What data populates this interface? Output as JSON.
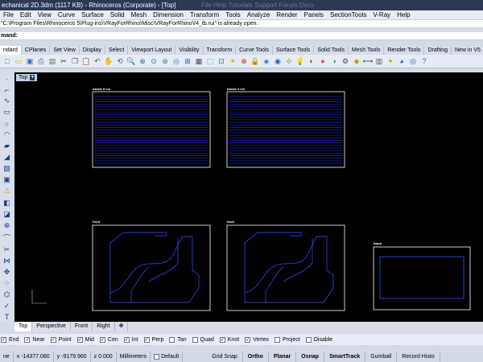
{
  "window": {
    "title": "echanical 2D.3dm (1117 KB) - Rhinoceros (Corporate) - [Top]",
    "background_ghost": "File    Help    Tutorials    Support    Forum    Docs"
  },
  "menu": [
    "File",
    "Edit",
    "View",
    "Curve",
    "Surface",
    "Solid",
    "Mesh",
    "Dimension",
    "Transform",
    "Tools",
    "Analyze",
    "Render",
    "Panels",
    "SectionTools",
    "V-Ray",
    "Help"
  ],
  "command": {
    "history": "\"C:\\Program Files\\Rhinoceros 5\\Plug-ins\\VRayForRhino\\Misc\\VRayForRhinoV4_tb.rui\" is already open.",
    "prompt": "mand:"
  },
  "toolbar_tabs": [
    {
      "label": "ndard",
      "active": true
    },
    {
      "label": "CPlanes"
    },
    {
      "label": "Set View"
    },
    {
      "label": "Display"
    },
    {
      "label": "Select"
    },
    {
      "label": "Viewport Layout"
    },
    {
      "label": "Visibility"
    },
    {
      "label": "Transform"
    },
    {
      "label": "Curve Tools"
    },
    {
      "label": "Surface Tools"
    },
    {
      "label": "Solid Tools"
    },
    {
      "label": "Mesh Tools"
    },
    {
      "label": "Render Tools"
    },
    {
      "label": "Drafting"
    },
    {
      "label": "New in V5"
    }
  ],
  "toolbar_icons": [
    {
      "name": "new-icon",
      "glyph": "□"
    },
    {
      "name": "open-icon",
      "glyph": "▭"
    },
    {
      "name": "save-icon",
      "glyph": "▣"
    },
    {
      "name": "print-icon",
      "glyph": "⎙"
    },
    {
      "name": "import-icon",
      "glyph": "▤"
    },
    {
      "name": "cut-icon",
      "glyph": "✂"
    },
    {
      "name": "copy-icon",
      "glyph": "❐"
    },
    {
      "name": "paste-icon",
      "glyph": "📋"
    },
    {
      "name": "undo-icon",
      "glyph": "↶"
    },
    {
      "name": "pan-hand-icon",
      "glyph": "✋"
    },
    {
      "name": "rotate-icon",
      "glyph": "⟲"
    },
    {
      "name": "zoom-icon",
      "glyph": "🔍"
    },
    {
      "name": "zoom-window-icon",
      "glyph": "⊕"
    },
    {
      "name": "zoom-extents-icon",
      "glyph": "⊙"
    },
    {
      "name": "zoom-selected-icon",
      "glyph": "⊚"
    },
    {
      "name": "zoom-all-icon",
      "glyph": "◎"
    },
    {
      "name": "four-views-icon",
      "glyph": "⊞"
    },
    {
      "name": "grid-icon",
      "glyph": "▦"
    },
    {
      "name": "cplane-icon",
      "glyph": "⬚"
    },
    {
      "name": "select-icon",
      "glyph": "⊡"
    },
    {
      "name": "show-icon",
      "glyph": "☀"
    },
    {
      "name": "hide-icon",
      "glyph": "⊗"
    },
    {
      "name": "lock-icon",
      "glyph": "🔒"
    },
    {
      "name": "layer-icon",
      "glyph": "◈"
    },
    {
      "name": "properties-icon",
      "glyph": "◉"
    },
    {
      "name": "osnap-icon",
      "glyph": "⊹"
    },
    {
      "name": "light-icon",
      "glyph": "💡"
    },
    {
      "name": "render-icon",
      "glyph": "◐"
    },
    {
      "name": "material-icon",
      "glyph": "●"
    },
    {
      "name": "environment-icon",
      "glyph": "◑"
    },
    {
      "name": "options-icon",
      "glyph": "⚙"
    },
    {
      "name": "color-icon",
      "glyph": "◆"
    },
    {
      "name": "dimension-icon",
      "glyph": "⟷"
    },
    {
      "name": "layout-icon",
      "glyph": "▥"
    },
    {
      "name": "wand-icon",
      "glyph": "✦"
    },
    {
      "name": "raytrace-icon",
      "glyph": "◕"
    },
    {
      "name": "vray-render-icon",
      "glyph": "◎"
    },
    {
      "name": "help-icon",
      "glyph": "?"
    }
  ],
  "left_tools": [
    {
      "name": "point-icon",
      "glyph": "·"
    },
    {
      "name": "polyline-icon",
      "glyph": "⌐"
    },
    {
      "name": "curve-icon",
      "glyph": "∿"
    },
    {
      "name": "rectangle-icon",
      "glyph": "▭"
    },
    {
      "name": "circle-icon",
      "glyph": "○"
    },
    {
      "name": "arc-icon",
      "glyph": "◠"
    },
    {
      "name": "surface-icon",
      "glyph": "▰"
    },
    {
      "name": "sweep-icon",
      "glyph": "◢"
    },
    {
      "name": "loft-icon",
      "glyph": "▧"
    },
    {
      "name": "box-icon",
      "glyph": "▣"
    },
    {
      "name": "warning-icon",
      "glyph": "⚠",
      "warn": true
    },
    {
      "name": "solid-icon",
      "glyph": "◧"
    },
    {
      "name": "mesh-icon",
      "glyph": "◪"
    },
    {
      "name": "boolean-icon",
      "glyph": "⊕"
    },
    {
      "name": "fillet-icon",
      "glyph": "⌒"
    },
    {
      "name": "trim-icon",
      "glyph": "✂"
    },
    {
      "name": "join-icon",
      "glyph": "⋈"
    },
    {
      "name": "move-icon",
      "glyph": "✥"
    },
    {
      "name": "array-icon",
      "glyph": "⁘"
    },
    {
      "name": "analyze-icon",
      "glyph": "⌬"
    },
    {
      "name": "check-icon",
      "glyph": "✓"
    },
    {
      "name": "text-icon",
      "glyph": "T"
    }
  ],
  "viewport": {
    "name": "Top",
    "labels": [
      "bands 5 cm",
      "bands 3 cm",
      "front",
      "back",
      "black"
    ]
  },
  "view_tabs": [
    {
      "label": "Top",
      "active": true
    },
    {
      "label": "Perspective"
    },
    {
      "label": "Front"
    },
    {
      "label": "Right"
    },
    {
      "label": "✥"
    }
  ],
  "osnaps": [
    {
      "label": "End",
      "checked": true
    },
    {
      "label": "Near",
      "checked": true
    },
    {
      "label": "Point",
      "checked": true
    },
    {
      "label": "Mid",
      "checked": true
    },
    {
      "label": "Cen",
      "checked": true
    },
    {
      "label": "Int",
      "checked": true
    },
    {
      "label": "Perp",
      "checked": true
    },
    {
      "label": "Tan",
      "checked": false
    },
    {
      "label": "Quad",
      "checked": false
    },
    {
      "label": "Knot",
      "checked": true
    },
    {
      "label": "Vertex",
      "checked": true
    },
    {
      "label": "Project",
      "checked": false
    },
    {
      "label": "Disable",
      "checked": false
    }
  ],
  "status": {
    "plane": "ne",
    "x": "x -14377.080",
    "y": "y -9179.960",
    "z": "z 0.000",
    "units": "Millimeters",
    "layer": "Default",
    "toggles": [
      "Grid Snap",
      "Ortho",
      "Planar",
      "Osnap",
      "SmartTrack",
      "Gumball",
      "Record Histo"
    ]
  },
  "colors": {
    "band_lines": "#1e23c8",
    "frame": "#ffffff",
    "profile": "#2a3fd6",
    "viewport_bg": "#000000"
  }
}
